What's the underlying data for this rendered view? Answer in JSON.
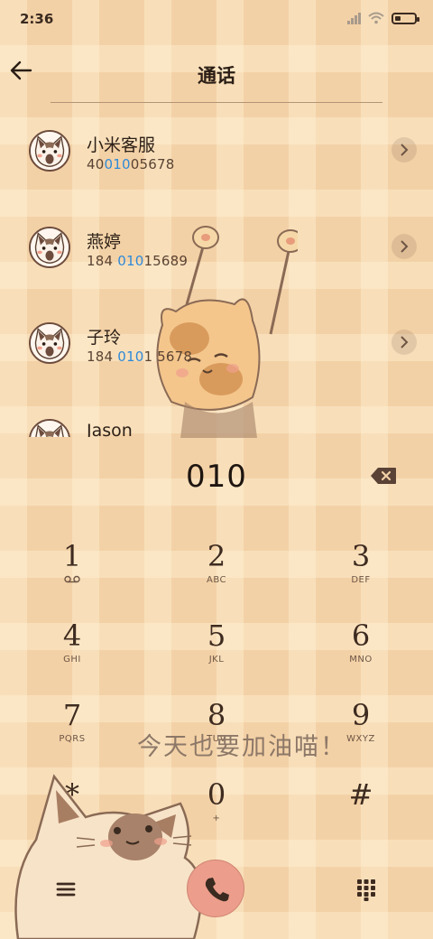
{
  "status_bar": {
    "time": "2:36"
  },
  "header": {
    "title": "通话"
  },
  "contacts": [
    {
      "name": "小米客服",
      "number_pre": "40",
      "number_hl": "010",
      "number_post": "05678"
    },
    {
      "name": "燕婷",
      "number_pre": "184 ",
      "number_hl": "010",
      "number_post": "15689"
    },
    {
      "name": "子玲",
      "number_pre": "184 ",
      "number_hl": "010",
      "number_post": "1 5678"
    },
    {
      "name": "Jason",
      "number_pre": "",
      "number_hl": "",
      "number_post": ""
    }
  ],
  "dial": {
    "number": "010"
  },
  "keypad": [
    {
      "digit": "1",
      "letters": "⌂"
    },
    {
      "digit": "2",
      "letters": "ABC"
    },
    {
      "digit": "3",
      "letters": "DEF"
    },
    {
      "digit": "4",
      "letters": "GHI"
    },
    {
      "digit": "5",
      "letters": "JKL"
    },
    {
      "digit": "6",
      "letters": "MNO"
    },
    {
      "digit": "7",
      "letters": "PQRS"
    },
    {
      "digit": "8",
      "letters": "TUV"
    },
    {
      "digit": "9",
      "letters": "WXYZ"
    },
    {
      "digit": "*",
      "letters": ","
    },
    {
      "digit": "0",
      "letters": "+"
    },
    {
      "digit": "#",
      "letters": ""
    }
  ],
  "slogan": "今天也要加油喵！",
  "icons": {
    "back": "back-arrow-icon",
    "chevron": "chevron-right-icon",
    "backspace": "backspace-icon",
    "menu": "menu-icon",
    "call": "phone-icon",
    "dialpad": "dialpad-icon"
  },
  "colors": {
    "accent": "#2f8ad9",
    "call": "#ec9d8b",
    "background": "#f3d1a6"
  }
}
